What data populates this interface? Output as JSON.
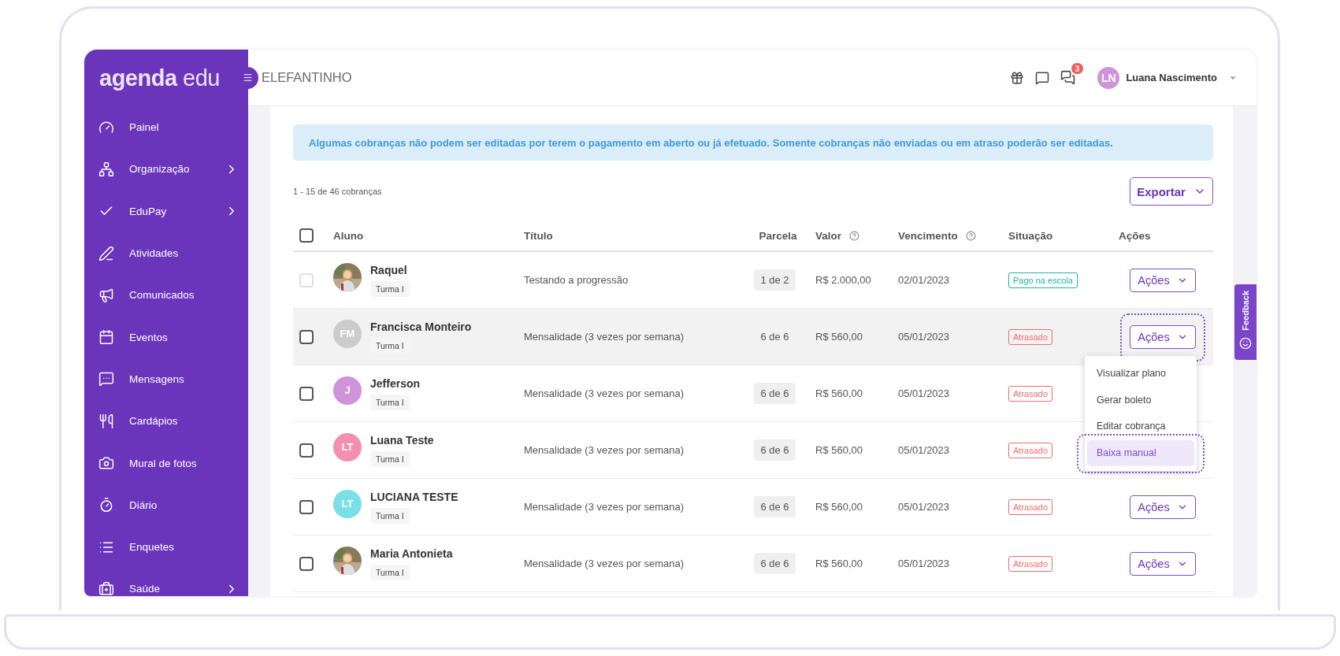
{
  "logo": "**agenda** edu",
  "sidebar": {
    "items": [
      {
        "label": "Painel",
        "submenu": false
      },
      {
        "label": "Organização",
        "submenu": true
      },
      {
        "label": "EduPay",
        "submenu": true
      },
      {
        "label": "Atividades",
        "submenu": false
      },
      {
        "label": "Comunicados",
        "submenu": false
      },
      {
        "label": "Eventos",
        "submenu": false
      },
      {
        "label": "Mensagens",
        "submenu": false
      },
      {
        "label": "Cardápios",
        "submenu": false
      },
      {
        "label": "Mural de fotos",
        "submenu": false
      },
      {
        "label": "Diário",
        "submenu": false
      },
      {
        "label": "Enquetes",
        "submenu": false
      },
      {
        "label": "Saúde",
        "submenu": true
      }
    ]
  },
  "header": {
    "school": "ELEFANTINHO",
    "notifications_badge": "3",
    "user": {
      "initials": "LN",
      "name": "Luana Nascimento"
    }
  },
  "notice": "Algumas cobranças não podem ser editadas por terem o pagamento em aberto ou já efetuado. Somente cobranças não enviadas ou em atraso poderão ser editadas.",
  "count": "1 - 15 de 46 cobranças",
  "export_button": "Exportar",
  "table": {
    "select_all": {
      "checked": false
    },
    "columns": [
      {
        "label": "Aluno",
        "help": false
      },
      {
        "label": "Título",
        "help": false
      },
      {
        "label": "Parcela",
        "help": false
      },
      {
        "label": "Valor",
        "help": true
      },
      {
        "label": "Vencimento",
        "help": true
      },
      {
        "label": "Situação",
        "help": false
      },
      {
        "label": "Ações",
        "help": false
      }
    ],
    "rows": [
      {
        "name": "Raquel",
        "class": "Turma I",
        "title": "Testando a progressão",
        "installment": "1 de 2",
        "amount": "R$ 2.000,00",
        "due": "02/01/2023",
        "status": {
          "label": "Pago na escola",
          "kind": "paid"
        },
        "actions": "Ações",
        "checked": false,
        "disabled": true,
        "hovered": false,
        "actions_highlighted": false
      },
      {
        "name": "Francisca Monteiro",
        "class": "Turma I",
        "avatar": {
          "kind": "initials",
          "initials": "FM",
          "color": "#cccccc"
        },
        "title": "Mensalidade (3 vezes por semana)",
        "installment": "6 de 6",
        "amount": "R$ 560,00",
        "due": "05/01/2023",
        "status": {
          "label": "Atrasado",
          "kind": "late"
        },
        "actions": "Ações",
        "checked": false,
        "disabled": false,
        "hovered": true,
        "actions_highlighted": true
      },
      {
        "name": "Jefferson",
        "class": "Turma I",
        "avatar": {
          "kind": "initials",
          "initials": "J",
          "color": "#cf93da"
        },
        "title": "Mensalidade (3 vezes por semana)",
        "installment": "6 de 6",
        "amount": "R$ 560,00",
        "due": "05/01/2023",
        "status": {
          "label": "Atrasado",
          "kind": "late"
        },
        "checked": false,
        "disabled": false,
        "hovered": false,
        "actions_highlighted": false
      },
      {
        "name": "Luana Teste",
        "class": "Turma I",
        "avatar": {
          "kind": "initials",
          "initials": "LT",
          "color": "#f48fb1"
        },
        "title": "Mensalidade (3 vezes por semana)",
        "installment": "6 de 6",
        "amount": "R$ 560,00",
        "due": "05/01/2023",
        "status": {
          "label": "Atrasado",
          "kind": "late"
        },
        "checked": false,
        "disabled": false,
        "hovered": false,
        "actions_highlighted": false
      },
      {
        "name": "LUCIANA TESTE",
        "class": "Turma I",
        "avatar": {
          "kind": "initials",
          "initials": "LT",
          "color": "#7adfe9"
        },
        "title": "Mensalidade (3 vezes por semana)",
        "installment": "6 de 6",
        "amount": "R$ 560,00",
        "due": "05/01/2023",
        "status": {
          "label": "Atrasado",
          "kind": "late"
        },
        "actions": "Ações",
        "checked": false,
        "disabled": false,
        "hovered": false,
        "actions_highlighted": false
      },
      {
        "name": "Maria Antonieta",
        "class": "Turma I",
        "title": "Mensalidade (3 vezes por semana)",
        "installment": "6 de 6",
        "amount": "R$ 560,00",
        "due": "05/01/2023",
        "status": {
          "label": "Atrasado",
          "kind": "late"
        },
        "actions": "Ações",
        "checked": false,
        "disabled": false,
        "hovered": false,
        "actions_highlighted": false
      }
    ]
  },
  "actions_menu": {
    "open": true,
    "items": [
      {
        "label": "Visualizar plano",
        "selected": false,
        "highlighted": false
      },
      {
        "label": "Gerar boleto",
        "selected": false,
        "highlighted": false
      },
      {
        "label": "Editar cobrança",
        "selected": false,
        "highlighted": false
      },
      {
        "label": "Baixa manual",
        "selected": true,
        "highlighted": true
      }
    ]
  },
  "feedback_tab": "Feedback"
}
